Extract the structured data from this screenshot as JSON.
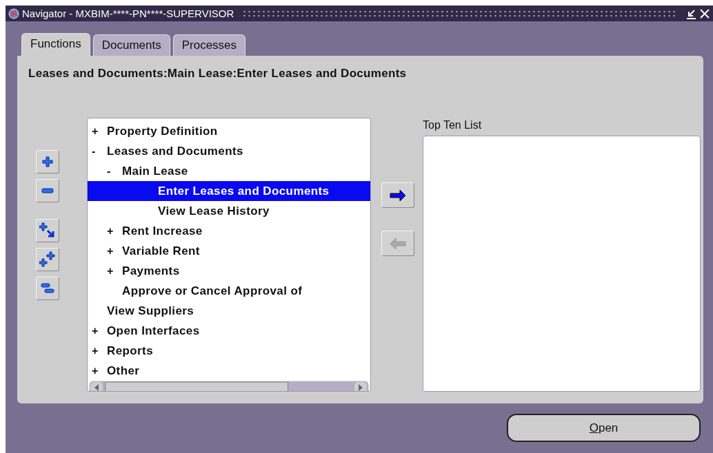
{
  "window": {
    "title": "Navigator - MXBIM-****-PN****-SUPERVISOR"
  },
  "tabs": [
    {
      "label": "Functions",
      "selected": true
    },
    {
      "label": "Documents",
      "selected": false
    },
    {
      "label": "Processes",
      "selected": false
    }
  ],
  "path": "Leases and Documents:Main Lease:Enter Leases and Documents",
  "tree": [
    {
      "marker": "+",
      "label": "Property Definition",
      "selected": false
    },
    {
      "marker": "-",
      "label": "Leases and Documents",
      "selected": false,
      "children": [
        {
          "marker": "-",
          "label": "Main Lease",
          "selected": false,
          "children": [
            {
              "label": "Enter Leases and Documents",
              "selected": true
            },
            {
              "label": "View Lease History",
              "selected": false
            }
          ]
        },
        {
          "marker": "+",
          "label": "Rent Increase",
          "selected": false
        },
        {
          "marker": "+",
          "label": "Variable Rent",
          "selected": false
        },
        {
          "marker": "+",
          "label": "Payments",
          "selected": false
        },
        {
          "label": "Approve or Cancel Approval of",
          "selected": false
        }
      ]
    },
    {
      "label": "View Suppliers",
      "selected": false
    },
    {
      "marker": "+",
      "label": "Open Interfaces",
      "selected": false
    },
    {
      "marker": "+",
      "label": "Reports",
      "selected": false
    },
    {
      "marker": "+",
      "label": "Other",
      "selected": false
    }
  ],
  "tree_buttons": [
    {
      "kind": "expand",
      "disabled": false
    },
    {
      "kind": "collapse",
      "disabled": false
    },
    {
      "kind": "expand_branch",
      "disabled": false
    },
    {
      "kind": "expand_all",
      "disabled": false
    },
    {
      "kind": "collapse_all",
      "disabled": false
    }
  ],
  "transfer_buttons": [
    {
      "kind": "add",
      "disabled": false
    },
    {
      "kind": "remove",
      "disabled": true
    }
  ],
  "top_ten": {
    "label": "Top Ten List"
  },
  "open_button": {
    "label": "Open"
  }
}
